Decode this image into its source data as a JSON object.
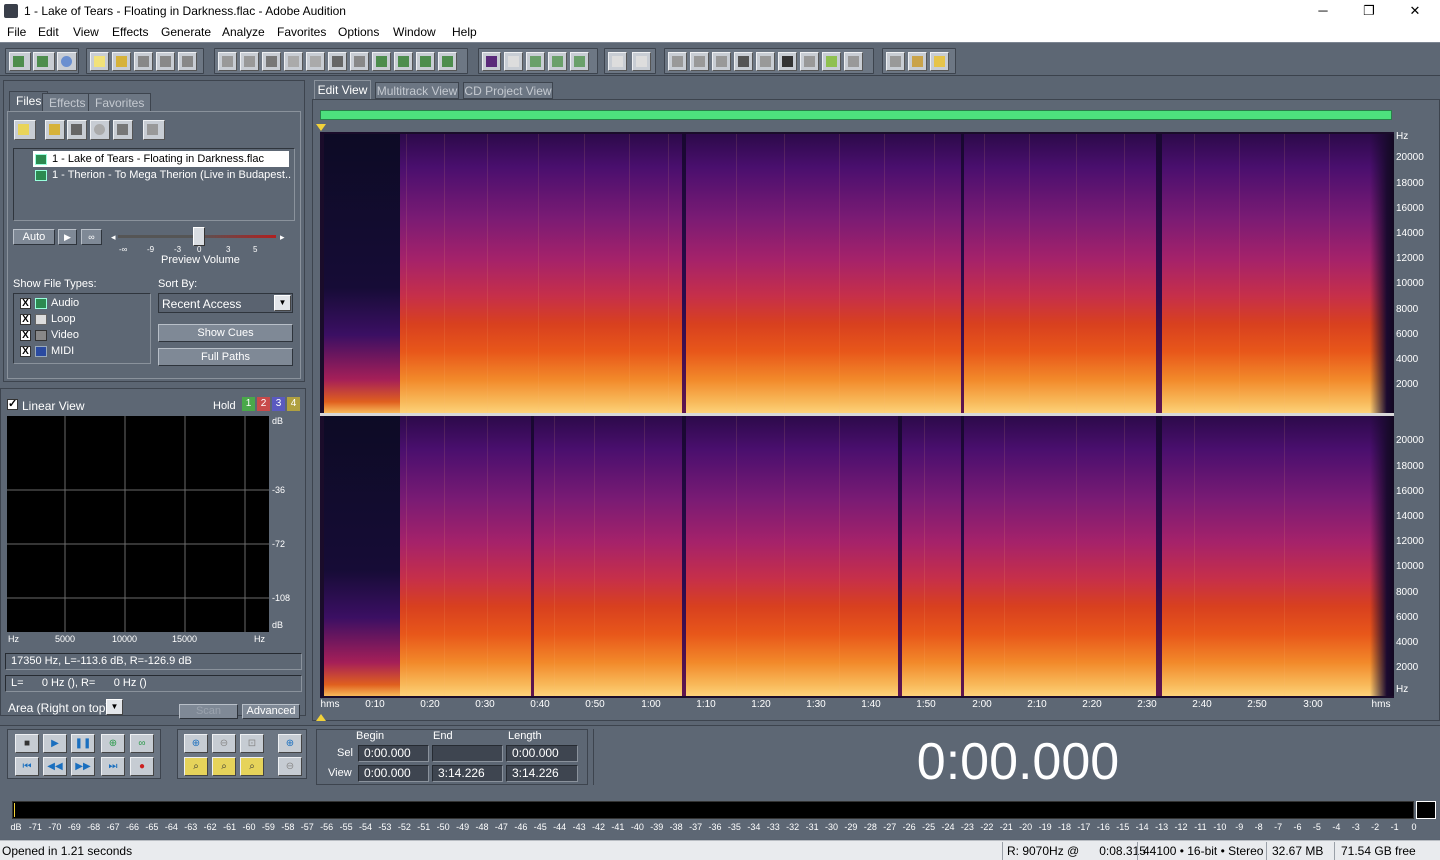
{
  "window": {
    "title": "1 - Lake of Tears - Floating in Darkness.flac - Adobe Audition",
    "minimize": "─",
    "maximize": "❐",
    "close": "✕"
  },
  "menu": [
    "File",
    "Edit",
    "View",
    "Effects",
    "Generate",
    "Analyze",
    "Favorites",
    "Options",
    "Window",
    "Help"
  ],
  "left_tabs": [
    "Files",
    "Effects",
    "Favorites"
  ],
  "files": [
    "1 - Lake of Tears - Floating in Darkness.flac",
    "1 - Therion - To Mega Therion (Live in Budapest..."
  ],
  "auto_button": "Auto",
  "preview": {
    "label": "Preview Volume",
    "ticks": [
      "-∞",
      "-9",
      "-3",
      "0",
      "3",
      "5"
    ]
  },
  "show_file_types": {
    "label": "Show File Types:",
    "items": [
      "Audio",
      "Loop",
      "Video",
      "MIDI"
    ],
    "checked_mark": "X"
  },
  "sort_by": {
    "label": "Sort By:",
    "value": "Recent Access",
    "dropdown_glyph": "▼"
  },
  "show_cues_button": "Show Cues",
  "full_paths_button": "Full Paths",
  "analyzer": {
    "linear_view_label": "Linear View",
    "hold_label": "Hold",
    "hold_buttons": [
      "1",
      "2",
      "3",
      "4"
    ],
    "db_labels": [
      "dB",
      "-36",
      "-72",
      "-108",
      "dB"
    ],
    "hz_labels": [
      "Hz",
      "5000",
      "10000",
      "15000",
      "Hz"
    ],
    "readout_1": "17350 Hz, L=-113.6 dB, R=-126.9 dB",
    "readout_2": "L=      0 Hz (), R=      0 Hz ()",
    "area_label": "Area (Right on top)",
    "scan_button": "Scan",
    "advanced_button": "Advanced"
  },
  "edit_tabs": [
    "Edit View",
    "Multitrack View",
    "CD Project View"
  ],
  "hz_axis_top": [
    "Hz",
    "20000",
    "18000",
    "16000",
    "14000",
    "12000",
    "10000",
    "8000",
    "6000",
    "4000",
    "2000"
  ],
  "hz_axis_bottom": [
    "20000",
    "18000",
    "16000",
    "14000",
    "12000",
    "10000",
    "8000",
    "6000",
    "4000",
    "2000",
    "Hz"
  ],
  "time_axis": [
    "hms",
    "0:10",
    "0:20",
    "0:30",
    "0:40",
    "0:50",
    "1:00",
    "1:10",
    "1:20",
    "1:30",
    "1:40",
    "1:50",
    "2:00",
    "2:10",
    "2:20",
    "2:30",
    "2:40",
    "2:50",
    "3:00",
    "hms"
  ],
  "selection": {
    "headers": [
      "Begin",
      "End",
      "Length"
    ],
    "sel_label": "Sel",
    "view_label": "View",
    "sel": [
      "0:00.000",
      "",
      "0:00.000"
    ],
    "view": [
      "0:00.000",
      "3:14.226",
      "3:14.226"
    ]
  },
  "big_time": "0:00.000",
  "meter_labels": [
    "dB",
    "-71",
    "-70",
    "-69",
    "-68",
    "-67",
    "-66",
    "-65",
    "-64",
    "-63",
    "-62",
    "-61",
    "-60",
    "-59",
    "-58",
    "-57",
    "-56",
    "-55",
    "-54",
    "-53",
    "-52",
    "-51",
    "-50",
    "-49",
    "-48",
    "-47",
    "-46",
    "-45",
    "-44",
    "-43",
    "-42",
    "-41",
    "-40",
    "-39",
    "-38",
    "-37",
    "-36",
    "-35",
    "-34",
    "-33",
    "-32",
    "-31",
    "-30",
    "-29",
    "-28",
    "-27",
    "-26",
    "-25",
    "-24",
    "-23",
    "-22",
    "-21",
    "-20",
    "-19",
    "-18",
    "-17",
    "-16",
    "-15",
    "-14",
    "-13",
    "-12",
    "-11",
    "-10",
    "-9",
    "-8",
    "-7",
    "-6",
    "-5",
    "-4",
    "-3",
    "-2",
    "-1",
    "0"
  ],
  "status": {
    "left": "Opened in 1.21 seconds",
    "cursor": "R: 9070Hz @      0:08.315",
    "format": "44100 • 16-bit • Stereo",
    "size": "32.67 MB",
    "free": "71.54 GB free"
  },
  "colors": {
    "accent_green": "#4de07d",
    "panel": "#5d6774"
  }
}
